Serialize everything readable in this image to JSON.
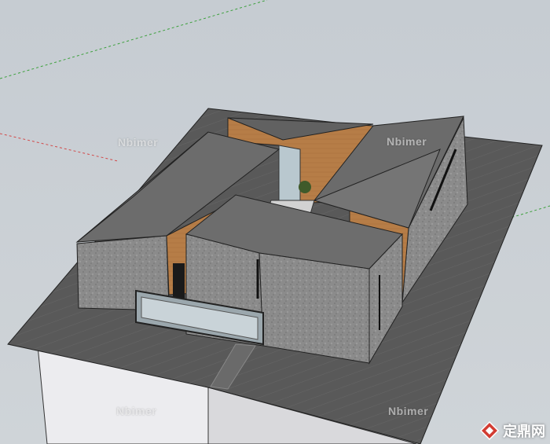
{
  "viewport": {
    "background": "#c9ced3",
    "colors": {
      "slab_top": "#5a5a5a",
      "slab_side": "#e6e6e8",
      "roof": "#6e6e6e",
      "stone_wall": "#8a8a8a",
      "wood_wall": "#b8804a",
      "axis_red": "#d24a4a",
      "axis_green": "#3ca03c"
    }
  },
  "watermarks": [
    "Nbimer",
    "Nbimer",
    "Nbimer",
    "Nbimer"
  ],
  "logo": {
    "text": "定鼎网",
    "icon": "diamond-logo-icon"
  }
}
